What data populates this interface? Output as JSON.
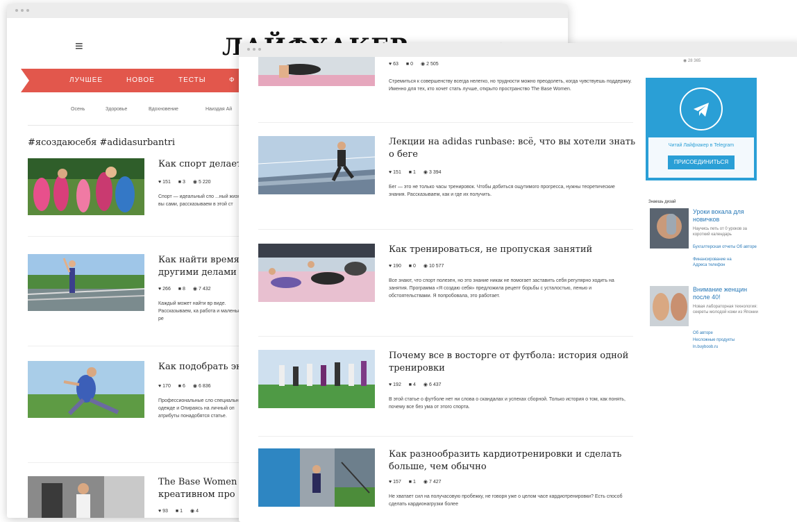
{
  "back": {
    "logo": "ЛАЙФХАКЕР",
    "nav": [
      "ЛУЧШЕЕ",
      "НОВОЕ",
      "ТЕСТЫ",
      "Ф"
    ],
    "subnav": [
      "Осень",
      "Здоровье",
      "Вдохновение",
      "Наиздая Ай"
    ],
    "hashtag": "#ясоздаюсебя #adidasurbantri",
    "articles": [
      {
        "title": "Как спорт делает",
        "likes": "151",
        "comments": "3",
        "views": "5 220",
        "excerpt": "Спорт — идеальный спо ...ный жизни и вы сами, рассказываем в этой ст"
      },
      {
        "title": "Как найти время с другими делами",
        "likes": "266",
        "comments": "8",
        "views": "7 432",
        "excerpt": "Каждый может найти вр виде. Рассказываем, ка работа и маленький ре"
      },
      {
        "title": "Как подобрать эк",
        "likes": "170",
        "comments": "6",
        "views": "6 836",
        "excerpt": "Профессиональные сло специальной одежде и Опираясь на личный оп атрибуты понадобятся статье."
      },
      {
        "title": "The Base Women креативном про",
        "likes": "93",
        "comments": "1",
        "views": "4"
      }
    ]
  },
  "front": {
    "top_meta": {
      "likes": "63",
      "comments": "0",
      "views": "2 505"
    },
    "top_excerpt": "Стремиться к совершенству всегда нелегко, но трудности можно преодолеть, когда чувствуешь поддержку. Именно для тех, кто хочет стать лучше, открыто пространство The Base Women.",
    "top_views_right": "28 365",
    "articles": [
      {
        "title": "Лекции на adidas runbase: всё, что вы хотели знать о беге",
        "likes": "151",
        "comments": "1",
        "views": "3 394",
        "excerpt": "Бег — это не только часы тренировок. Чтобы добиться ощутимого прогресса, нужны теоретические знания. Рассказываем, как и где их получить."
      },
      {
        "title": "Как тренироваться, не пропуская занятий",
        "likes": "190",
        "comments": "0",
        "views": "10 577",
        "excerpt": "Все знают, что спорт полезен, но это знание никак не помогает заставить себя регулярно ходить на занятия. Программа «Я создаю себя» предложила рецепт борьбы с усталостью, ленью и обстоятельствами. Я попробовала, это работает."
      },
      {
        "title": "Почему все в восторге от футбола: история одной тренировки",
        "likes": "192",
        "comments": "4",
        "views": "6 437",
        "excerpt": "В этой статье о футболе нет ни слова о скандалах и успехах сборной. Только история о том, как понять, почему все без ума от этого спорта."
      },
      {
        "title": "Как разнообразить кардиотренировки и сделать больше, чем обычно",
        "likes": "157",
        "comments": "1",
        "views": "7 427",
        "excerpt": "Не хватает сил на получасовую пробежку, не говоря уже о целом часе кардиотренировки? Есть способ сделать кардионагрузки более"
      }
    ],
    "telegram": {
      "text": "Читай Лайфхакер в Telegram",
      "button": "ПРИСОЕДИНИТЬСЯ"
    },
    "sidebar": {
      "label": "Знаешь дизай",
      "items": [
        {
          "title": "Уроки вокала для новичков",
          "small": "Научись петь от 0 уроков за короткий календарь",
          "links": [
            "Бухгалтерская отчеты  Об авторе",
            "Финансирование на",
            "Адреса телефон"
          ]
        },
        {
          "title": "Внимание женщин после 40!",
          "small": "Новая лабораторная технология: секреты молодой кожи из Японии",
          "links": [
            "Об авторе",
            "Несложные продукты",
            "ln.buyboob.ru"
          ]
        }
      ]
    }
  }
}
